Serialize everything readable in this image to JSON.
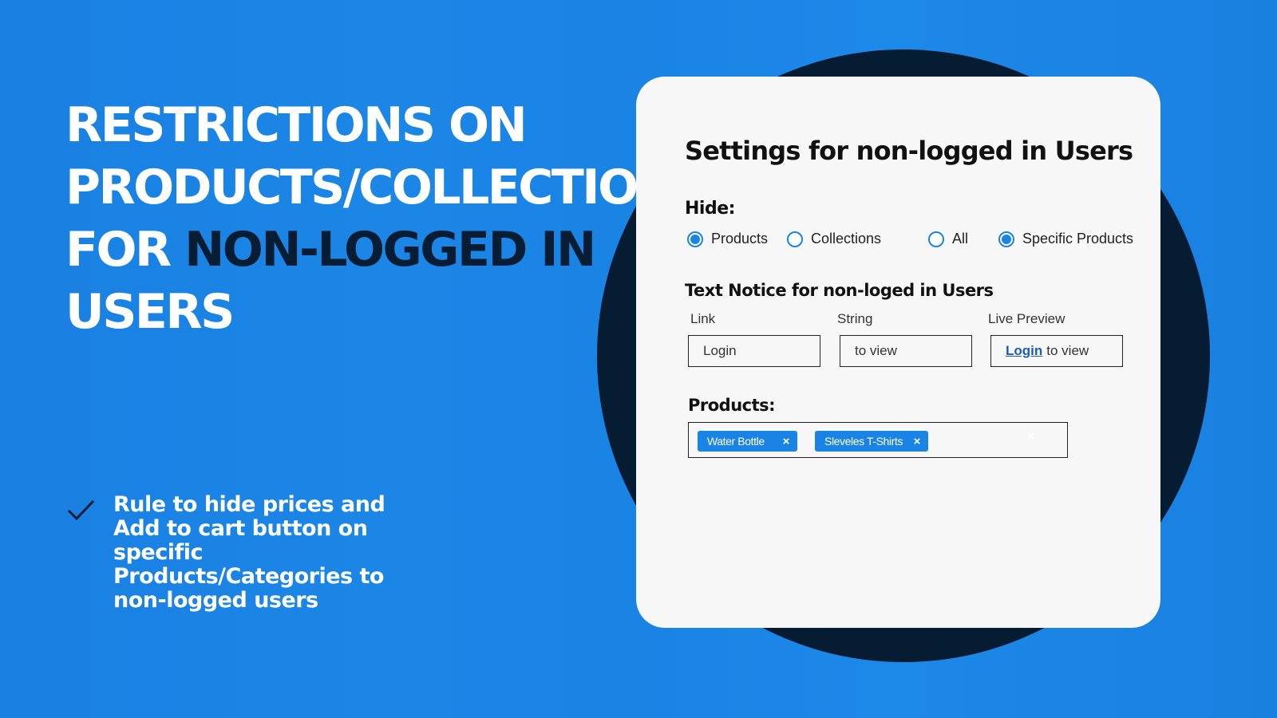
{
  "hero": {
    "line1": "RESTRICTIONS ON",
    "line2": "PRODUCTS/COLLECTIONS",
    "line3_prefix": "FOR ",
    "line3_highlight": "NON-LOGGED IN",
    "line4": "USERS"
  },
  "feature": {
    "icon": "check-icon",
    "text": "Rule to hide prices and Add to cart button on specific Products/Categories to non-logged users"
  },
  "colors": {
    "background": "#1a84e5",
    "dark": "#061c33",
    "card": "#f7f7f7",
    "accent": "#1a84e5"
  },
  "settings": {
    "title": "Settings for non-logged in Users",
    "hide_label": "Hide:",
    "hide_options": [
      {
        "label": "Products",
        "selected": true
      },
      {
        "label": "Collections",
        "selected": false
      },
      {
        "label": "All",
        "selected": false
      },
      {
        "label": "Specific Products",
        "selected": true
      }
    ],
    "notice_title": "Text Notice for non-loged in Users",
    "link_label": "Link",
    "link_value": "Login",
    "string_label": "String",
    "string_value": "to view",
    "preview_label": "Live Preview",
    "preview_link": "Login",
    "preview_text": "to view",
    "products_label": "Products:",
    "products": [
      {
        "label": "Water Bottle",
        "remove_icon": "×"
      },
      {
        "label": "Sleveles T-Shirts",
        "remove_icon": "×"
      }
    ],
    "clear_icon": "×"
  }
}
